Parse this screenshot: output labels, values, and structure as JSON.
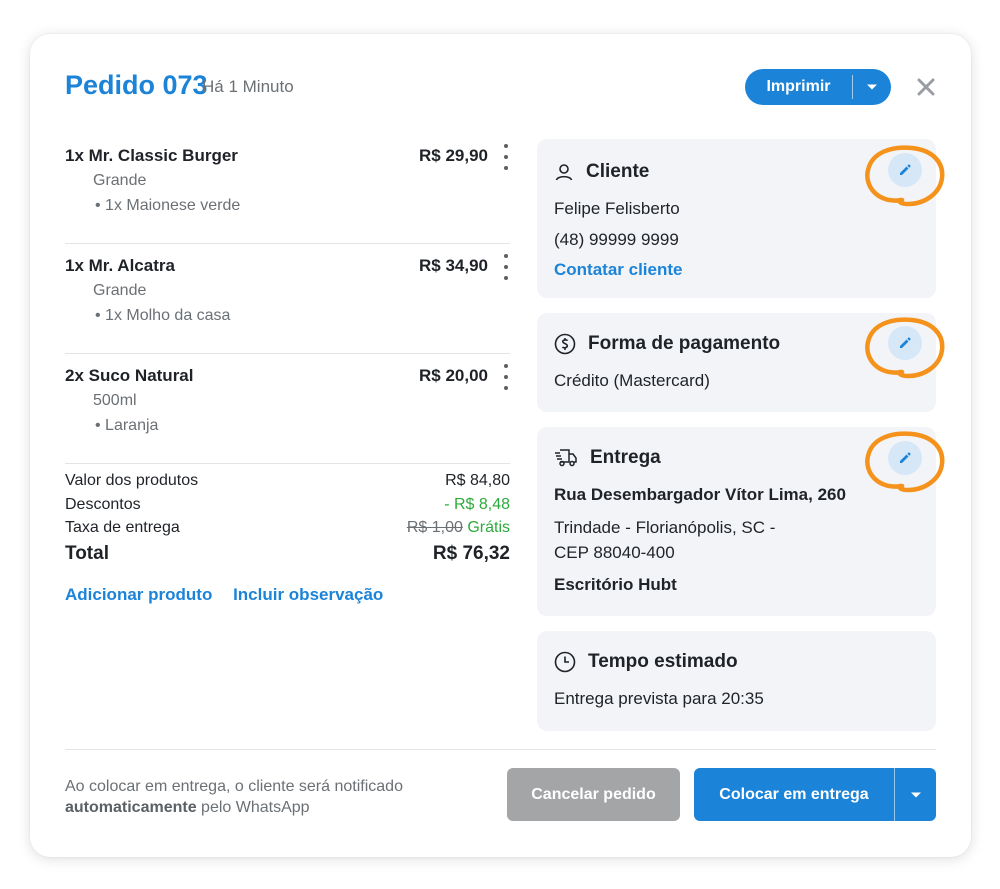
{
  "header": {
    "title": "Pedido 073",
    "time_ago": "Há 1 Minuto",
    "print_label": "Imprimir"
  },
  "items": [
    {
      "name": "1x Mr. Classic Burger",
      "price": "R$ 29,90",
      "variant": "Grande",
      "addon": "• 1x Maionese verde"
    },
    {
      "name": "1x Mr. Alcatra",
      "price": "R$ 34,90",
      "variant": "Grande",
      "addon": "• 1x Molho da casa"
    },
    {
      "name": "2x Suco Natural",
      "price": "R$ 20,00",
      "variant": "500ml",
      "addon": "• Laranja"
    }
  ],
  "summary": {
    "products_label": "Valor dos produtos",
    "products_value": "R$ 84,80",
    "discount_label": "Descontos",
    "discount_value": "- R$ 8,48",
    "delivery_label": "Taxa de entrega",
    "delivery_old": "R$ 1,00",
    "delivery_value": "Grátis",
    "total_label": "Total",
    "total_value": "R$ 76,32"
  },
  "actions": {
    "add_product": "Adicionar produto",
    "add_note": "Incluir observação"
  },
  "customer": {
    "title": "Cliente",
    "name": "Felipe Felisberto",
    "phone": "(48) 99999 9999",
    "contact_link": "Contatar cliente"
  },
  "payment": {
    "title": "Forma de pagamento",
    "method": "Crédito (Mastercard)"
  },
  "delivery": {
    "title": "Entrega",
    "street": "Rua Desembargador Vítor Lima, 260",
    "city": "Trindade - Florianópolis, SC -",
    "zip": "CEP 88040-400",
    "reference": "Escritório Hubt"
  },
  "estimate": {
    "title": "Tempo estimado",
    "text": "Entrega prevista para 20:35"
  },
  "footer": {
    "note_line1": "Ao colocar em entrega, o cliente será notificado",
    "note_bold": "automaticamente",
    "note_rest": " pelo WhatsApp",
    "cancel_label": "Cancelar pedido",
    "deliver_label": "Colocar em entrega"
  },
  "colors": {
    "accent": "#1c84d8",
    "success": "#2eaa3c",
    "highlight_ring": "#f5921b",
    "card_bg": "#f2f4f7"
  }
}
